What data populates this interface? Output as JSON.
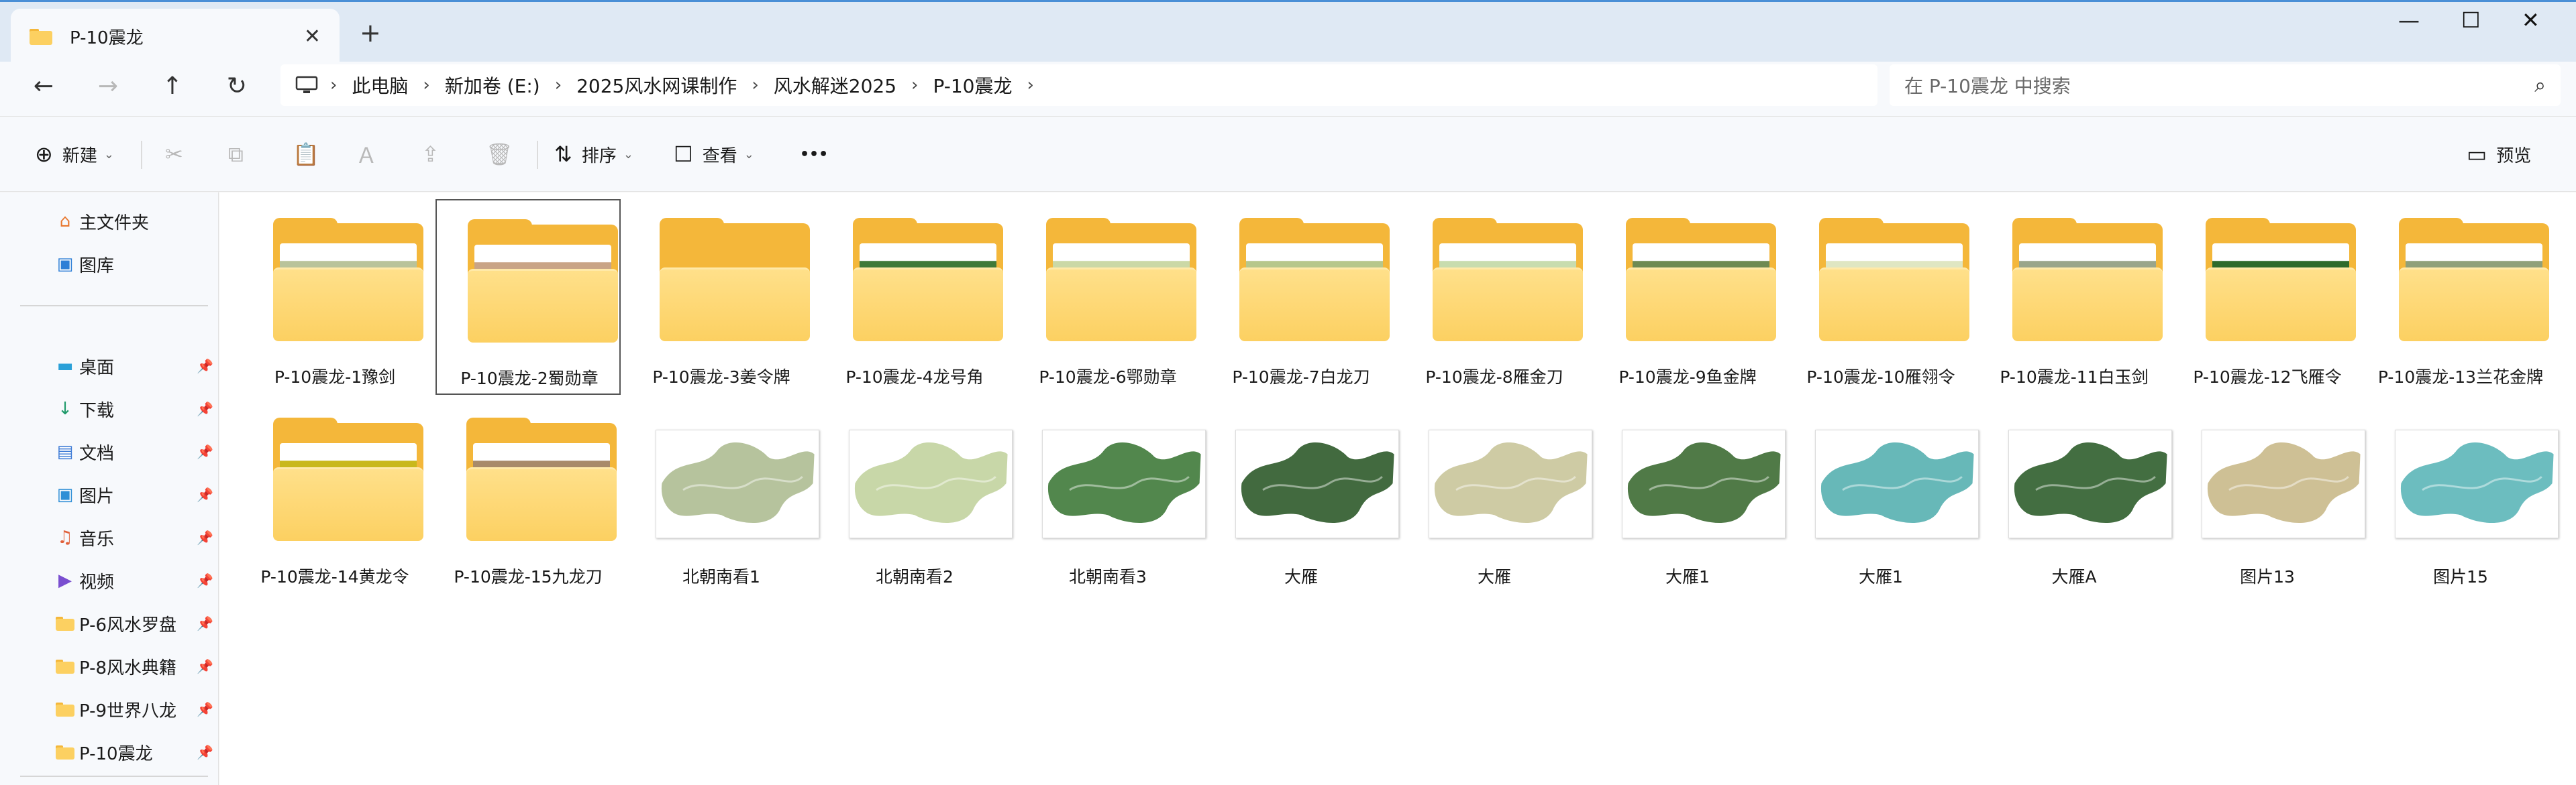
{
  "window": {
    "tab_title": "P-10震龙",
    "tab_close": "✕",
    "new_tab": "+",
    "minimize": "—",
    "maximize": "☐",
    "close": "✕"
  },
  "nav": {
    "back": "←",
    "forward": "→",
    "up": "↑",
    "refresh": "↻",
    "breadcrumbs": [
      "此电脑",
      "新加卷 (E:)",
      "2025风水网课制作",
      "风水解迷2025",
      "P-10震龙"
    ],
    "sep": "›",
    "search_placeholder": "在 P-10震龙 中搜索",
    "search_icon": "⌕"
  },
  "toolbar": {
    "new_label": "新建",
    "sort_label": "排序",
    "view_label": "查看",
    "more_label": "•••",
    "preview_label": "预览",
    "chev": "⌄",
    "icons": {
      "new": "⊕",
      "cut": "✂",
      "copy": "⧉",
      "paste": "📋",
      "rename": "Ａ",
      "share": "⇪",
      "delete": "🗑",
      "sort": "⇅",
      "view": "☐",
      "preview": "▭"
    }
  },
  "sidebar": {
    "pin": "📌",
    "top": [
      {
        "label": "主文件夹",
        "icon": "home-icon",
        "glyph": "⌂",
        "color": "#e8772e"
      },
      {
        "label": "图库",
        "icon": "gallery-icon",
        "glyph": "▣",
        "color": "#2f7fd6"
      }
    ],
    "quick": [
      {
        "label": "桌面",
        "icon": "desktop-icon",
        "glyph": "▬",
        "color": "#2aa0d8"
      },
      {
        "label": "下载",
        "icon": "download-icon",
        "glyph": "↓",
        "color": "#1f9a6a"
      },
      {
        "label": "文档",
        "icon": "documents-icon",
        "glyph": "▤",
        "color": "#3d7bd6"
      },
      {
        "label": "图片",
        "icon": "pictures-icon",
        "glyph": "▣",
        "color": "#2f8fd6"
      },
      {
        "label": "音乐",
        "icon": "music-icon",
        "glyph": "♫",
        "color": "#e0603a"
      },
      {
        "label": "视频",
        "icon": "videos-icon",
        "glyph": "▶",
        "color": "#7a4fd0"
      },
      {
        "label": "P-6风水罗盘",
        "icon": "folder-icon",
        "glyph": "",
        "color": "#f4b73a"
      },
      {
        "label": "P-8风水典籍",
        "icon": "folder-icon",
        "glyph": "",
        "color": "#f4b73a"
      },
      {
        "label": "P-9世界八龙",
        "icon": "folder-icon",
        "glyph": "",
        "color": "#f4b73a"
      },
      {
        "label": "P-10震龙",
        "icon": "folder-icon",
        "glyph": "",
        "color": "#f4b73a"
      }
    ]
  },
  "files": [
    {
      "name": "P-10震龙-1豫剑",
      "kind": "folder",
      "preview": "#b9c39a"
    },
    {
      "name": "P-10震龙-2蜀勋章",
      "kind": "folder",
      "preview": "#c9a486",
      "selected": true
    },
    {
      "name": "P-10震龙-3姜令牌",
      "kind": "folder",
      "preview": ""
    },
    {
      "name": "P-10震龙-4龙号角",
      "kind": "folder",
      "preview": "#3f7a3a"
    },
    {
      "name": "P-10震龙-6鄂勋章",
      "kind": "folder",
      "preview": "#cbd8a6"
    },
    {
      "name": "P-10震龙-7白龙刀",
      "kind": "folder",
      "preview": "#b7c78b"
    },
    {
      "name": "P-10震龙-8雁金刀",
      "kind": "folder",
      "preview": "#c8dcae"
    },
    {
      "name": "P-10震龙-9鱼金牌",
      "kind": "folder",
      "preview": "#6e8a52"
    },
    {
      "name": "P-10震龙-10雁翎令",
      "kind": "folder",
      "preview": "#dfe6c2"
    },
    {
      "name": "P-10震龙-11白玉剑",
      "kind": "folder",
      "preview": "#9aa58a"
    },
    {
      "name": "P-10震龙-12飞雁令",
      "kind": "folder",
      "preview": "#2f6a2c"
    },
    {
      "name": "P-10震龙-13兰花金牌",
      "kind": "folder",
      "preview": "#8fa07a"
    },
    {
      "name": "P-10震龙-14黄龙令",
      "kind": "folder",
      "preview": "#c9b81c"
    },
    {
      "name": "P-10震龙-15九龙刀",
      "kind": "folder",
      "preview": "#a88a6a"
    },
    {
      "name": "北朝南看1",
      "kind": "image",
      "color": "#aebd92"
    },
    {
      "name": "北朝南看2",
      "kind": "image",
      "color": "#c2d39e"
    },
    {
      "name": "北朝南看3",
      "kind": "image",
      "color": "#3f7a3a"
    },
    {
      "name": "大雁",
      "kind": "image",
      "color": "#2e5a2a"
    },
    {
      "name": "大雁",
      "kind": "image",
      "color": "#c9c59a"
    },
    {
      "name": "大雁1",
      "kind": "image",
      "color": "#3d6b33"
    },
    {
      "name": "大雁1",
      "kind": "image",
      "color": "#56b0b0"
    },
    {
      "name": "大雁A",
      "kind": "image",
      "color": "#2f5e2c"
    },
    {
      "name": "图片13",
      "kind": "image",
      "color": "#c9b98a"
    },
    {
      "name": "图片15",
      "kind": "image",
      "color": "#5cb6b8"
    }
  ]
}
